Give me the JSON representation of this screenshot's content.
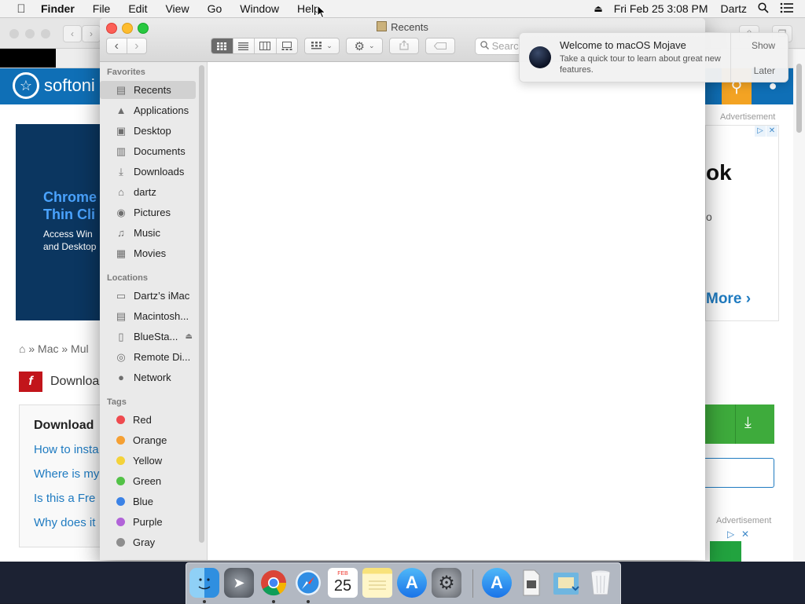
{
  "menubar": {
    "apple_icon": "apple-icon",
    "app_name": "Finder",
    "menus": [
      "File",
      "Edit",
      "View",
      "Go",
      "Window",
      "Help"
    ],
    "clock": "Fri Feb 25  3:08 PM",
    "user": "Dartz"
  },
  "background_page": {
    "logo_text": "softoni",
    "ad": {
      "heading_line1": "Chrome",
      "heading_line2": "Thin Cli",
      "body_line1": "Access Win",
      "body_line2": "and Desktop"
    },
    "breadcrumb": "» Mac » Mul",
    "title": "Downloa",
    "faq": {
      "heading": "Download",
      "links": [
        "How to insta",
        "Where is my",
        "Is this a Fre",
        "Why does it"
      ]
    },
    "right_ad_label": "Advertisement",
    "right_ad_big": "ok",
    "right_ad_small": "o",
    "right_ad_more": "More",
    "right_ad_label_2": "Advertisement"
  },
  "finder": {
    "title": "Recents",
    "search_placeholder": "Search",
    "sidebar": {
      "favorites_heading": "Favorites",
      "favorites": [
        {
          "label": "Recents",
          "icon": "recents-icon"
        },
        {
          "label": "Applications",
          "icon": "applications-icon"
        },
        {
          "label": "Desktop",
          "icon": "desktop-icon"
        },
        {
          "label": "Documents",
          "icon": "documents-icon"
        },
        {
          "label": "Downloads",
          "icon": "downloads-icon"
        },
        {
          "label": "dartz",
          "icon": "home-icon"
        },
        {
          "label": "Pictures",
          "icon": "camera-icon"
        },
        {
          "label": "Music",
          "icon": "music-icon"
        },
        {
          "label": "Movies",
          "icon": "film-icon"
        }
      ],
      "locations_heading": "Locations",
      "locations": [
        {
          "label": "Dartz’s iMac",
          "icon": "imac-icon"
        },
        {
          "label": "Macintosh...",
          "icon": "disk-icon"
        },
        {
          "label": "BlueSta...",
          "icon": "disk-icon"
        },
        {
          "label": "Remote Di...",
          "icon": "disc-icon"
        },
        {
          "label": "Network",
          "icon": "globe-icon"
        }
      ],
      "tags_heading": "Tags",
      "tags": [
        {
          "label": "Red",
          "color": "#ef4a4f"
        },
        {
          "label": "Orange",
          "color": "#f5a033"
        },
        {
          "label": "Yellow",
          "color": "#f4d23a"
        },
        {
          "label": "Green",
          "color": "#53c247"
        },
        {
          "label": "Blue",
          "color": "#3b82e6"
        },
        {
          "label": "Purple",
          "color": "#b163d8"
        },
        {
          "label": "Gray",
          "color": "#8e8e8e"
        }
      ]
    }
  },
  "notification": {
    "title": "Welcome to macOS Mojave",
    "body": "Take a quick tour to learn about great new features.",
    "show_button": "Show",
    "later_button": "Later"
  },
  "dock": {
    "calendar_month": "FEB",
    "calendar_day": "25",
    "apps": [
      "finder-icon",
      "launchpad-icon",
      "chrome-icon",
      "safari-icon",
      "calendar-icon",
      "notes-icon",
      "app-store-icon",
      "system-preferences-icon",
      "app-store-folder-icon",
      "document-icon",
      "downloads-stack-icon",
      "trash-icon"
    ]
  }
}
